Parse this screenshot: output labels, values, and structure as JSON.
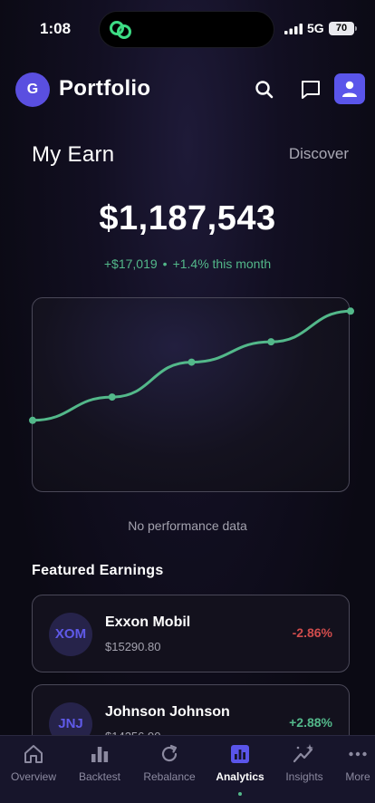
{
  "status_bar": {
    "time": "1:08",
    "network": "5G",
    "battery": "70"
  },
  "header": {
    "avatar_initial": "G",
    "title": "Portfolio"
  },
  "earn": {
    "title": "My Earn",
    "discover_label": "Discover",
    "balance": "$1,187,543",
    "change_amount": "+$17,019",
    "change_separator": "•",
    "change_percent": "+1.4% this month"
  },
  "chart_data": {
    "type": "line",
    "title": "",
    "xlabel": "",
    "ylabel": "",
    "x": [
      1,
      2,
      3,
      4,
      5
    ],
    "values": [
      1150000,
      1158000,
      1170000,
      1177000,
      1187543
    ],
    "ylim": [
      1125000,
      1192000
    ],
    "grid": false,
    "line_color": "#53b88a"
  },
  "empty_note": "No performance data",
  "featured": {
    "title": "Featured Earnings",
    "items": [
      {
        "ticker": "XOM",
        "name": "Exxon Mobil",
        "price": "$15290.80",
        "change": "-2.86%",
        "direction": "negative"
      },
      {
        "ticker": "JNJ",
        "name": "Johnson  Johnson",
        "price": "$14256.90",
        "change": "+2.88%",
        "direction": "positive"
      }
    ]
  },
  "nav": {
    "items": [
      {
        "label": "Overview",
        "icon": "home-icon"
      },
      {
        "label": "Backtest",
        "icon": "bar-chart-icon"
      },
      {
        "label": "Rebalance",
        "icon": "refresh-icon"
      },
      {
        "label": "Analytics",
        "icon": "analytics-icon",
        "active": true
      },
      {
        "label": "Insights",
        "icon": "sparkle-trend-icon"
      },
      {
        "label": "More",
        "icon": "more-dots-icon"
      }
    ]
  },
  "colors": {
    "accent": "#5a55ea",
    "positive": "#53b88a",
    "negative": "#d04c4c",
    "background": "#0b0a14"
  }
}
